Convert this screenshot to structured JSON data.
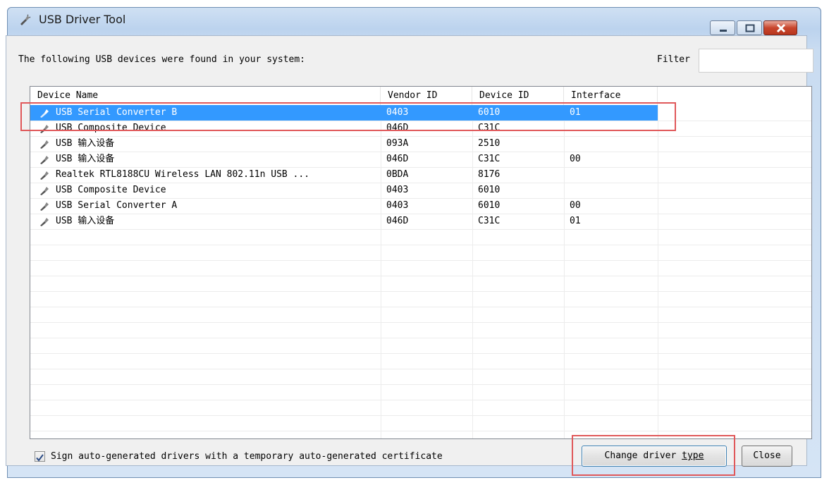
{
  "window": {
    "title": "USB Driver Tool"
  },
  "top_label": "The following USB devices were found in your system:",
  "filter": {
    "label": "Filter",
    "value": ""
  },
  "columns": [
    "Device Name",
    "Vendor ID",
    "Device ID",
    "Interface"
  ],
  "devices": [
    {
      "name": "USB Serial Converter B",
      "vendor": "0403",
      "device": "6010",
      "interface": "01",
      "selected": true
    },
    {
      "name": "USB Composite Device",
      "vendor": "046D",
      "device": "C31C",
      "interface": ""
    },
    {
      "name": "USB 输入设备",
      "vendor": "093A",
      "device": "2510",
      "interface": ""
    },
    {
      "name": "USB 输入设备",
      "vendor": "046D",
      "device": "C31C",
      "interface": "00"
    },
    {
      "name": "Realtek RTL8188CU Wireless LAN 802.11n USB ...",
      "vendor": "0BDA",
      "device": "8176",
      "interface": ""
    },
    {
      "name": "USB Composite Device",
      "vendor": "0403",
      "device": "6010",
      "interface": ""
    },
    {
      "name": "USB Serial Converter A",
      "vendor": "0403",
      "device": "6010",
      "interface": "00"
    },
    {
      "name": "USB 输入设备",
      "vendor": "046D",
      "device": "C31C",
      "interface": "01"
    }
  ],
  "checkbox": {
    "label": "Sign auto-generated drivers with a temporary auto-generated certificate",
    "checked": true
  },
  "buttons": {
    "change_driver_prefix": "Change driver ",
    "change_driver_accel": "type",
    "close": "Close"
  },
  "icons": {
    "app": "usb-plug-icon",
    "device": "usb-plug-icon"
  },
  "colors": {
    "selection": "#3399ff",
    "annotation": "#e0585a"
  }
}
